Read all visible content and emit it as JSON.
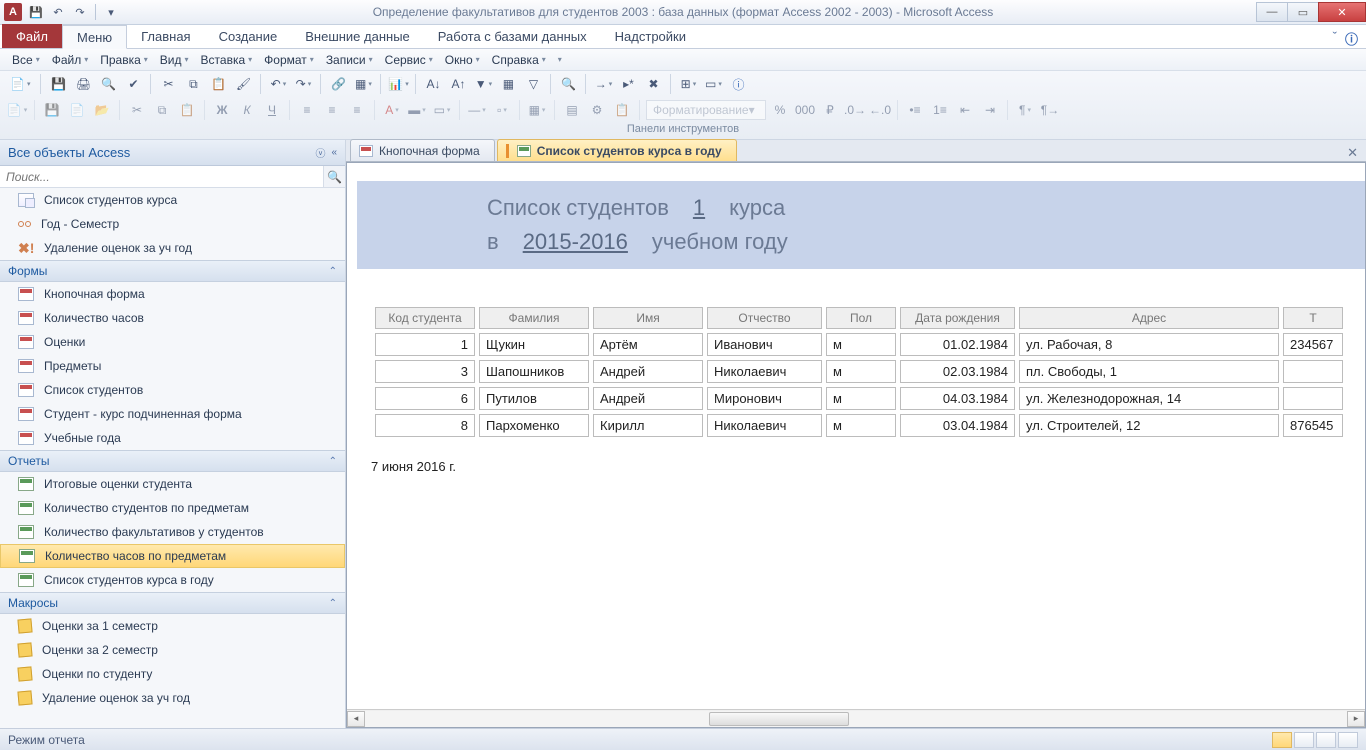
{
  "titlebar": {
    "app_letter": "A",
    "title": "Определение факультативов для студентов 2003 : база данных (формат Access 2002 - 2003)  -  Microsoft Access"
  },
  "ribbon": {
    "file": "Файл",
    "tabs": [
      "Меню",
      "Главная",
      "Создание",
      "Внешние данные",
      "Работа с базами данных",
      "Надстройки"
    ],
    "active_tab": 0
  },
  "menus": [
    "Все",
    "Файл",
    "Правка",
    "Вид",
    "Вставка",
    "Формат",
    "Записи",
    "Сервис",
    "Окно",
    "Справка"
  ],
  "toolbar": {
    "group_label": "Панели инструментов",
    "format_placeholder": "Форматирование"
  },
  "nav": {
    "header": "Все объекты Access",
    "search_placeholder": "Поиск...",
    "items_top": [
      {
        "icon": "query",
        "label": "Список студентов курса"
      },
      {
        "icon": "sp",
        "label": "Год - Семестр"
      },
      {
        "icon": "excl",
        "label": "Удаление оценок за уч год"
      }
    ],
    "groups": [
      {
        "title": "Формы",
        "icon": "form",
        "items": [
          "Кнопочная форма",
          "Количество часов",
          "Оценки",
          "Предметы",
          "Список студентов",
          "Студент - курс подчиненная форма",
          "Учебные года"
        ]
      },
      {
        "title": "Отчеты",
        "icon": "report",
        "items": [
          "Итоговые оценки студента",
          "Количество студентов по предметам",
          "Количество факультативов у студентов",
          "Количество часов по предметам",
          "Список студентов курса в году"
        ],
        "selected": 3
      },
      {
        "title": "Макросы",
        "icon": "macro",
        "items": [
          "Оценки за 1 семестр",
          "Оценки за 2 семестр",
          "Оценки по студенту",
          "Удаление оценок за уч год"
        ]
      }
    ]
  },
  "doctabs": [
    {
      "label": "Кнопочная форма",
      "icon": "form",
      "active": false
    },
    {
      "label": "Список студентов курса в году",
      "icon": "report",
      "active": true
    }
  ],
  "report": {
    "title_a": "Список студентов",
    "course_num": "1",
    "title_b": "курса",
    "row2_a": "в",
    "year": "2015-2016",
    "row2_b": "учебном году",
    "columns": [
      "Код студента",
      "Фамилия",
      "Имя",
      "Отчество",
      "Пол",
      "Дата рождения",
      "Адрес",
      "Т"
    ],
    "rows": [
      {
        "id": "1",
        "fam": "Щукин",
        "name": "Артём",
        "otch": "Иванович",
        "pol": "м",
        "dob": "01.02.1984",
        "addr": "ул. Рабочая, 8",
        "t": "234567"
      },
      {
        "id": "3",
        "fam": "Шапошников",
        "name": "Андрей",
        "otch": "Николаевич",
        "pol": "м",
        "dob": "02.03.1984",
        "addr": "пл. Свободы, 1",
        "t": ""
      },
      {
        "id": "6",
        "fam": "Путилов",
        "name": "Андрей",
        "otch": "Миронович",
        "pol": "м",
        "dob": "04.03.1984",
        "addr": "ул. Железнодорожная, 14",
        "t": ""
      },
      {
        "id": "8",
        "fam": "Пархоменко",
        "name": "Кирилл",
        "otch": "Николаевич",
        "pol": "м",
        "dob": "03.04.1984",
        "addr": "ул. Строителей, 12",
        "t": "876545"
      }
    ],
    "date": "7 июня 2016 г."
  },
  "status": {
    "text": "Режим отчета"
  }
}
